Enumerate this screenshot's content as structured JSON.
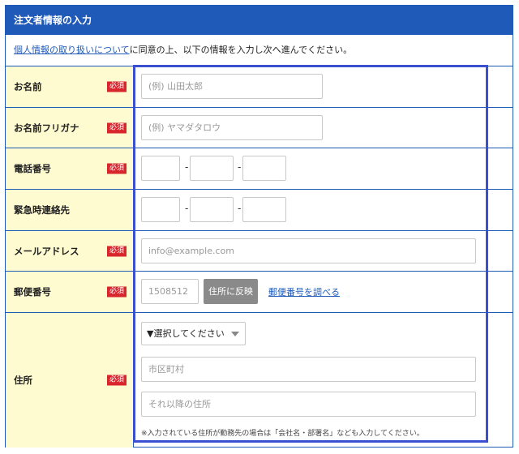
{
  "header": {
    "title": "注文者情報の入力"
  },
  "intro": {
    "link_text": "個人情報の取り扱いについて",
    "rest_text": "に同意の上、以下の情報を入力し次へ進んでください。"
  },
  "required_badge": "必須",
  "rows": {
    "name": {
      "label": "お名前",
      "placeholder": "(例) 山田太郎"
    },
    "kana": {
      "label": "お名前フリガナ",
      "placeholder": "(例) ヤマダタロウ"
    },
    "phone": {
      "label": "電話番号"
    },
    "emergency": {
      "label": "緊急時連絡先"
    },
    "email": {
      "label": "メールアドレス",
      "placeholder": "info@example.com"
    },
    "postal": {
      "label": "郵便番号",
      "placeholder": "1508512",
      "button": "住所に反映",
      "link": "郵便番号を調べる"
    },
    "address": {
      "label": "住所",
      "select_value": "▼選択してください",
      "city_placeholder": "市区町村",
      "rest_placeholder": "それ以降の住所",
      "note": "※入力されている住所が勤務先の場合は「会社名・部署名」なども入力してください。"
    }
  },
  "separator": "-",
  "colors": {
    "header": "#1f5ab8",
    "label_bg": "#fffbd0",
    "required": "#d9262c",
    "highlight": "#3b4fd1"
  }
}
